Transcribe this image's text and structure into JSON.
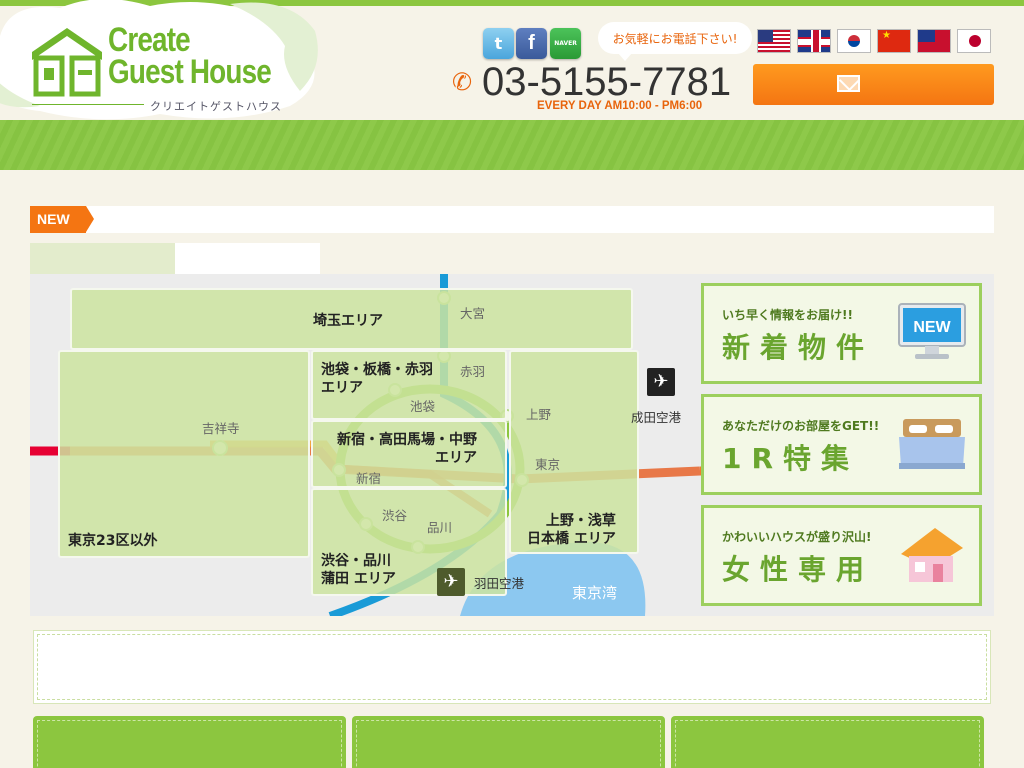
{
  "header": {
    "logo_title": "Create\nGuest House",
    "logo_subtitle": "クリエイトゲストハウス",
    "social": [
      "twitter-icon",
      "facebook-icon",
      "naver-icon"
    ],
    "social_labels": {
      "twitter": "t",
      "facebook": "f",
      "naver": "NAVER"
    },
    "call_bubble": "お気軽にお電話下さい!",
    "flags": [
      "us-flag",
      "uk-flag",
      "korea-flag",
      "china-flag",
      "taiwan-flag",
      "japan-flag"
    ],
    "phone": "03-5155-7781",
    "hours": "EVERY DAY AM10:00 - PM6:00",
    "mail_icon": "mail-icon"
  },
  "news": {
    "label": "NEW",
    "text": ""
  },
  "map": {
    "areas": [
      {
        "id": "saitama",
        "label": "埼玉エリア"
      },
      {
        "id": "outside23",
        "label": "東京23区以外"
      },
      {
        "id": "ikebukuro",
        "label": "池袋・板橋・赤羽\nエリア"
      },
      {
        "id": "shinjuku",
        "label": "新宿・高田馬場・中野\nエリア"
      },
      {
        "id": "shibuya",
        "label": "渋谷・品川\n蒲田 エリア"
      },
      {
        "id": "ueno",
        "label": "上野・浅草\n日本橋 エリア"
      }
    ],
    "stations": {
      "omiya": "大宮",
      "akabane": "赤羽",
      "ikebukuro": "池袋",
      "ueno": "上野",
      "kichijoji": "吉祥寺",
      "shinjuku": "新宿",
      "tokyo": "東京",
      "shibuya": "渋谷",
      "shinagawa": "品川"
    },
    "airports": {
      "narita": "成田空港",
      "haneda": "羽田空港"
    },
    "bay": "東京湾",
    "colors": {
      "yamanote": "#8cc63f",
      "saikyo": "#1a9bd7",
      "chuo": "#e8642c",
      "ginza": "#f39a1e",
      "keiyo": "#e60033",
      "bay": "#8cc8f0"
    }
  },
  "banners": [
    {
      "sub": "いち早く情報をお届け!!",
      "title": "新着物件",
      "image": "new-computer-icon",
      "badge": "NEW"
    },
    {
      "sub": "あなただけのお部屋をGET!!",
      "title": "1R特集",
      "image": "bed-icon"
    },
    {
      "sub": "かわいいハウスが盛り沢山!",
      "title": "女性専用",
      "image": "house-icon"
    }
  ]
}
